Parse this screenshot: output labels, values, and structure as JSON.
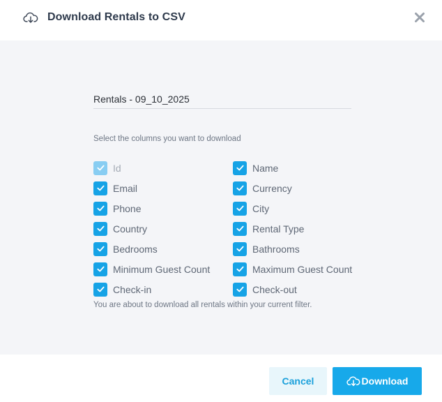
{
  "modal": {
    "title": "Download Rentals to CSV",
    "header_icon": "cloud-download-icon",
    "close_icon": "close-icon"
  },
  "form": {
    "filename_value": "Rentals - 09_10_2025",
    "columns_hint": "Select the columns you want to download",
    "columns_left": [
      {
        "label": "Id",
        "checked": true,
        "disabled": true
      },
      {
        "label": "Email",
        "checked": true,
        "disabled": false
      },
      {
        "label": "Phone",
        "checked": true,
        "disabled": false
      },
      {
        "label": "Country",
        "checked": true,
        "disabled": false
      },
      {
        "label": "Bedrooms",
        "checked": true,
        "disabled": false
      },
      {
        "label": "Minimum Guest Count",
        "checked": true,
        "disabled": false
      },
      {
        "label": "Check-in",
        "checked": true,
        "disabled": false
      }
    ],
    "columns_right": [
      {
        "label": "Name",
        "checked": true,
        "disabled": false
      },
      {
        "label": "Currency",
        "checked": true,
        "disabled": false
      },
      {
        "label": "City",
        "checked": true,
        "disabled": false
      },
      {
        "label": "Rental Type",
        "checked": true,
        "disabled": false
      },
      {
        "label": "Bathrooms",
        "checked": true,
        "disabled": false
      },
      {
        "label": "Maximum Guest Count",
        "checked": true,
        "disabled": false
      },
      {
        "label": "Check-out",
        "checked": true,
        "disabled": false
      }
    ],
    "filter_note": "You are about to download all rentals within your current filter."
  },
  "footer": {
    "cancel_label": "Cancel",
    "download_label": "Download",
    "download_icon": "cloud-download-icon"
  },
  "colors": {
    "accent": "#17a9ea",
    "checkbox": "#16a3e6",
    "checkbox_disabled": "#88cdf2",
    "body_bg": "#f4f5f8"
  }
}
